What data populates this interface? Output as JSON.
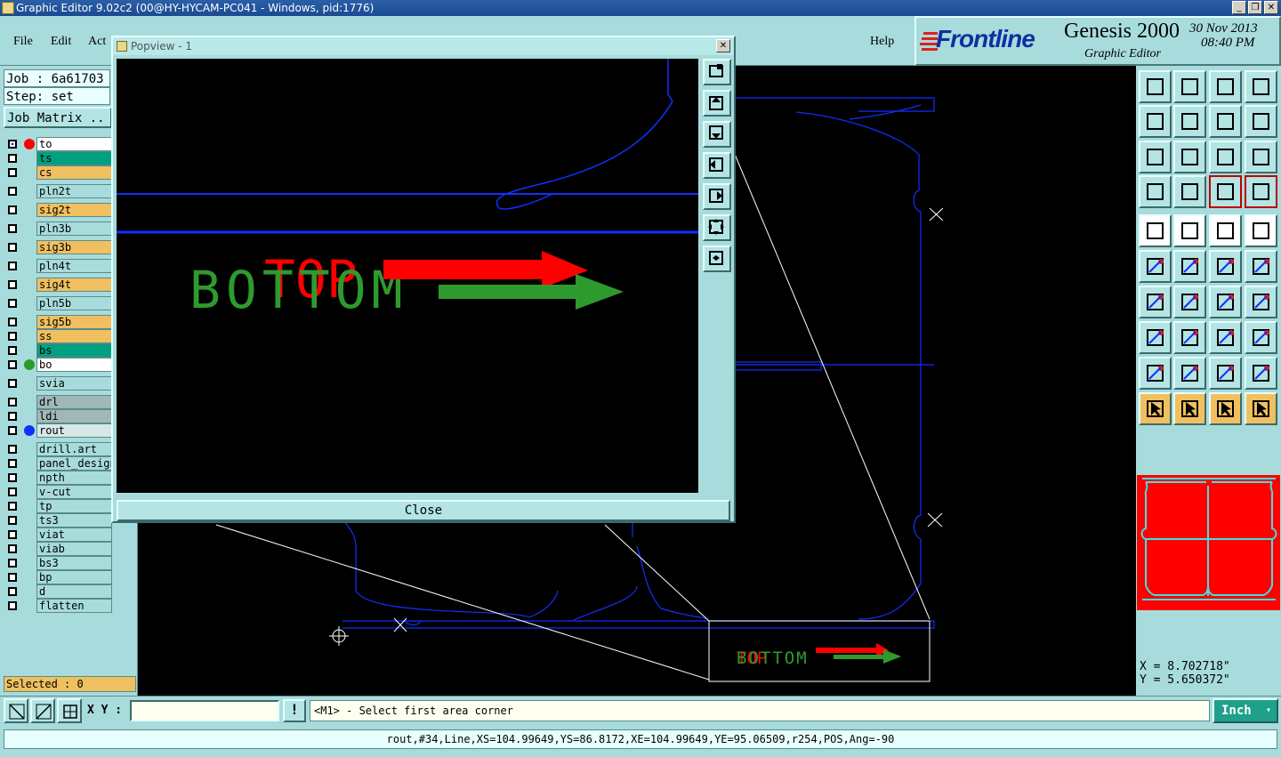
{
  "window": {
    "title": "Graphic Editor 9.02c2 (00@HY-HYCAM-PC041 - Windows, pid:1776)",
    "minimize": "_",
    "restore": "❐",
    "close": "✕"
  },
  "menu": {
    "file": "File",
    "edit": "Edit",
    "actions": "Act",
    "help": "Help"
  },
  "logo": {
    "brand": "Frontline",
    "product": "Genesis 2000",
    "subtitle": "Graphic Editor",
    "date": "30 Nov 2013",
    "time": "08:40 PM"
  },
  "job": {
    "job_label": "Job : 6a61703",
    "step_label": "Step: set",
    "matrix_button": "Job Matrix .."
  },
  "layers": [
    {
      "name": "to",
      "color": "#ffffff",
      "dot": "#ff0000",
      "checked": true
    },
    {
      "name": "ts",
      "color": "#00a080",
      "dot": null
    },
    {
      "name": "cs",
      "color": "#f0c060",
      "dot": null
    },
    {
      "name": "pln2t",
      "color": "#a8dcdc",
      "dot": null
    },
    {
      "name": "sig2t",
      "color": "#f0c060",
      "dot": null
    },
    {
      "name": "pln3b",
      "color": "#a8dcdc",
      "dot": null
    },
    {
      "name": "sig3b",
      "color": "#f0c060",
      "dot": null
    },
    {
      "name": "pln4t",
      "color": "#a8dcdc",
      "dot": null
    },
    {
      "name": "sig4t",
      "color": "#f0c060",
      "dot": null
    },
    {
      "name": "pln5b",
      "color": "#a8dcdc",
      "dot": null
    },
    {
      "name": "sig5b",
      "color": "#f0c060",
      "dot": null
    },
    {
      "name": "ss",
      "color": "#f0c060",
      "dot": null
    },
    {
      "name": "bs",
      "color": "#00a080",
      "dot": null
    },
    {
      "name": "bo",
      "color": "#ffffff",
      "dot": "#2e9a2e"
    },
    {
      "name": "svia",
      "color": "#a8dcdc",
      "dot": null
    },
    {
      "name": "drl",
      "color": "#a0b8b8",
      "dot": null
    },
    {
      "name": "ldi",
      "color": "#a0b8b8",
      "dot": null
    },
    {
      "name": "rout",
      "color": "#d8e8e8",
      "dot": "#1030ff"
    },
    {
      "name": "drill.art",
      "color": "#a8dcdc",
      "dot": null
    },
    {
      "name": "panel_design",
      "color": "#a8dcdc",
      "dot": null
    },
    {
      "name": "npth",
      "color": "#a8dcdc",
      "dot": null
    },
    {
      "name": "v-cut",
      "color": "#a8dcdc",
      "dot": null
    },
    {
      "name": "tp",
      "color": "#a8dcdc",
      "dot": null
    },
    {
      "name": "ts3",
      "color": "#a8dcdc",
      "dot": null
    },
    {
      "name": "viat",
      "color": "#a8dcdc",
      "dot": null
    },
    {
      "name": "viab",
      "color": "#a8dcdc",
      "dot": null
    },
    {
      "name": "bs3",
      "color": "#a8dcdc",
      "dot": null
    },
    {
      "name": "bp",
      "color": "#a8dcdc",
      "dot": null
    },
    {
      "name": "d",
      "color": "#a8dcdc",
      "dot": null
    },
    {
      "name": "flatten",
      "color": "#a8dcdc",
      "dot": null
    }
  ],
  "selected": "Selected : 0",
  "popview": {
    "title": "Popview - 1",
    "close_label": "Close",
    "text_bottom": "BOTTOM",
    "text_top": "TOP"
  },
  "canvas": {
    "text_bottom": "BOTTOM",
    "text_top": "TOP"
  },
  "coords": {
    "x": "X = 8.702718\"",
    "y": "Y = 5.650372\""
  },
  "bottombar": {
    "xy_label": "X Y :",
    "xy_value": "",
    "prompt": "<M1> - Select first area corner",
    "units": "Inch",
    "bang": "!"
  },
  "status": {
    "text": "rout,#34,Line,XS=104.99649,YS=86.8172,XE=104.99649,YE=95.06509,r254,POS,Ang=-90"
  },
  "colors": {
    "panel": "#a8dcdc",
    "rout": "#1030ff",
    "top": "#ff0000",
    "bottom": "#2e9a2e"
  }
}
